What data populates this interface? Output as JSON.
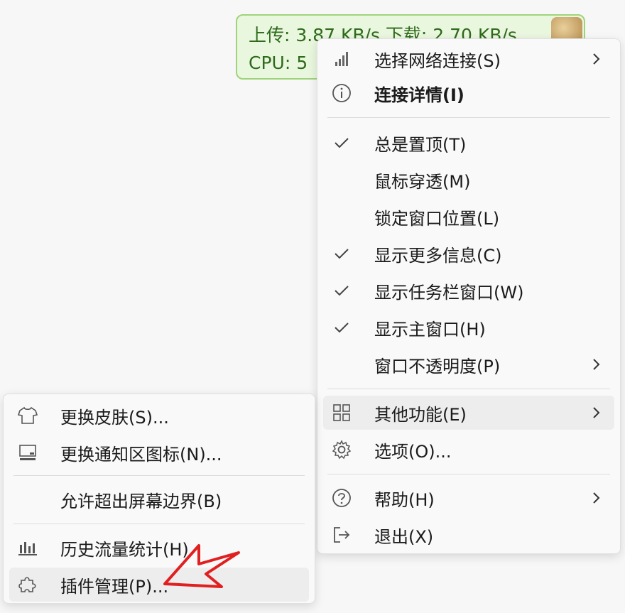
{
  "widget": {
    "line1": "上传: 3.87 KB/s    下载: 2.70 KB/s",
    "line2": "CPU: 5"
  },
  "main_menu": {
    "items": [
      {
        "label": "选择网络连接(S)",
        "icon": "signal-bars-icon",
        "submenu": true,
        "checked": false
      },
      {
        "label": "连接详情(I)",
        "icon": "info-circle-icon",
        "bold": true,
        "checked": false
      },
      {
        "label": "总是置顶(T)",
        "checked": true
      },
      {
        "label": "鼠标穿透(M)",
        "checked": false
      },
      {
        "label": "锁定窗口位置(L)",
        "checked": false
      },
      {
        "label": "显示更多信息(C)",
        "checked": true
      },
      {
        "label": "显示任务栏窗口(W)",
        "checked": true
      },
      {
        "label": "显示主窗口(H)",
        "checked": true
      },
      {
        "label": "窗口不透明度(P)",
        "submenu": true,
        "checked": false
      },
      {
        "label": "其他功能(E)",
        "icon": "grid-icon",
        "submenu": true,
        "highlighted": true
      },
      {
        "label": "选项(O)...",
        "icon": "gear-icon"
      },
      {
        "label": "帮助(H)",
        "icon": "help-circle-icon",
        "submenu": true
      },
      {
        "label": "退出(X)",
        "icon": "exit-icon"
      }
    ]
  },
  "sub_menu": {
    "items": [
      {
        "label": "更换皮肤(S)...",
        "icon": "shirt-icon"
      },
      {
        "label": "更换通知区图标(N)...",
        "icon": "tray-icon"
      },
      {
        "label": "允许超出屏幕边界(B)"
      },
      {
        "label": "历史流量统计(H)",
        "icon": "bar-chart-icon"
      },
      {
        "label": "插件管理(P)...",
        "icon": "puzzle-icon",
        "highlighted": true
      }
    ]
  },
  "colors": {
    "widget_border": "#9fd37a",
    "widget_bg": "#eaf7df",
    "widget_text": "#2e6a1b",
    "highlight": "#ededed",
    "annotation_arrow": "#e02020"
  }
}
